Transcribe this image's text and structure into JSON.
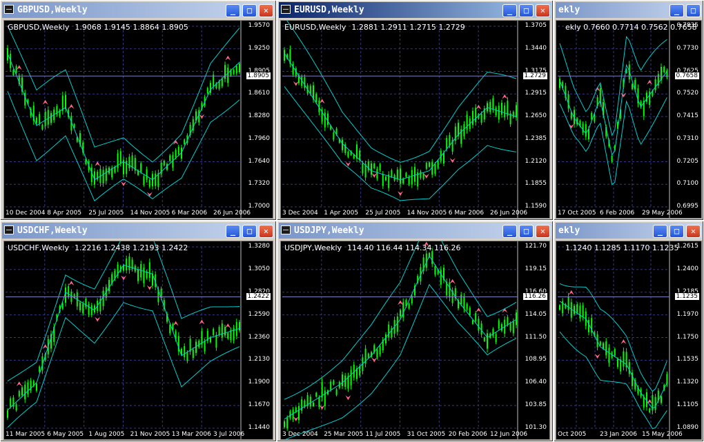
{
  "windows": [
    {
      "title": "GBPUSD,Weekly",
      "active": false,
      "header": {
        "symbol": "GBPUSD,Weekly",
        "ohlc": "1.9068 1.9145 1.8864 1.8905"
      },
      "y_labels": [
        "1.9570",
        "1.9250",
        "1.8905",
        "1.8610",
        "1.8280",
        "1.7960",
        "1.7640",
        "1.7320",
        "1.7000"
      ],
      "x_labels": [
        "10 Dec 2004",
        "8 Apr 2005",
        "25 Jul 2005",
        "14 Nov 2005",
        "6 Mar 2006",
        "26 Jun 2006"
      ],
      "current_price": "1.8905"
    },
    {
      "title": "EURUSD,Weekly",
      "active": true,
      "header": {
        "symbol": "EURUSD,Weekly",
        "ohlc": "1.2881 1.2911 1.2715 1.2729"
      },
      "y_labels": [
        "1.3705",
        "1.3440",
        "1.3175",
        "1.2915",
        "1.2650",
        "1.2385",
        "1.2120",
        "1.1855",
        "1.1590"
      ],
      "x_labels": [
        "3 Dec 2004",
        "1 Apr 2005",
        "25 Jul 2005",
        "14 Nov 2005",
        "6 Mar 2006",
        "26 Jun 2006"
      ],
      "current_price": "1.2729"
    },
    {
      "title": "USDCAD,Weekly",
      "active": false,
      "header": {
        "symbol": "",
        "ohlc": "ekly  0.7660 0.7714 0.7562 0.7658"
      },
      "y_labels": [
        "0.7835",
        "0.7730",
        "0.7625",
        "0.7520",
        "0.7415",
        "0.7310",
        "0.7205",
        "0.7100",
        "0.6995"
      ],
      "x_labels": [
        "17 Oct 2005",
        "6 Feb 2006",
        "29 May 2006"
      ],
      "current_price": "0.7658"
    },
    {
      "title": "USDCHF,Weekly",
      "active": false,
      "header": {
        "symbol": "USDCHF,Weekly",
        "ohlc": "1.2216 1.2438 1.2193 1.2422"
      },
      "y_labels": [
        "1.3280",
        "1.3050",
        "1.2820",
        "1.2590",
        "1.2360",
        "1.2130",
        "1.1900",
        "1.1670",
        "1.1440"
      ],
      "x_labels": [
        "11 Mar 2005",
        "6 May 2005",
        "1 Aug 2005",
        "21 Nov 2005",
        "13 Mar 2006",
        "3 Jul 2006"
      ],
      "current_price": "1.2422"
    },
    {
      "title": "USDJPY,Weekly",
      "active": false,
      "header": {
        "symbol": "USDJPY,Weekly",
        "ohlc": "114.40 116.44 114.34 116.26"
      },
      "y_labels": [
        "121.70",
        "119.15",
        "116.60",
        "114.05",
        "111.50",
        "108.95",
        "106.40",
        "103.85",
        "101.30"
      ],
      "x_labels": [
        "3 Dec 2004",
        "25 Mar 2005",
        "11 Jul 2005",
        "31 Oct 2005",
        "20 Feb 2006",
        "12 Jun 2006"
      ],
      "current_price": "116.26"
    },
    {
      "title": "AUDUSD,Weekly",
      "active": false,
      "header": {
        "symbol": "",
        "ohlc": "1.1240 1.1285 1.1170 1.1235"
      },
      "y_labels": [
        "1.2615",
        "1.2400",
        "1.2185",
        "1.1970",
        "1.1750",
        "1.1535",
        "1.1320",
        "1.1105",
        "1.0890"
      ],
      "x_labels": [
        "Oct 2005",
        "23 Jan 2006",
        "15 May 2006"
      ],
      "current_price": "1.1235"
    }
  ],
  "colors": {
    "candles": "#00ff00",
    "bands": "#00d0d0",
    "arrows": "#ff6688",
    "grid": "#3a3a7a"
  },
  "title_visible": [
    "GBPUSD,Weekly",
    "EURUSD,Weekly",
    "ekly",
    "USDCHF,Weekly",
    "USDJPY,Weekly",
    "ekly"
  ]
}
